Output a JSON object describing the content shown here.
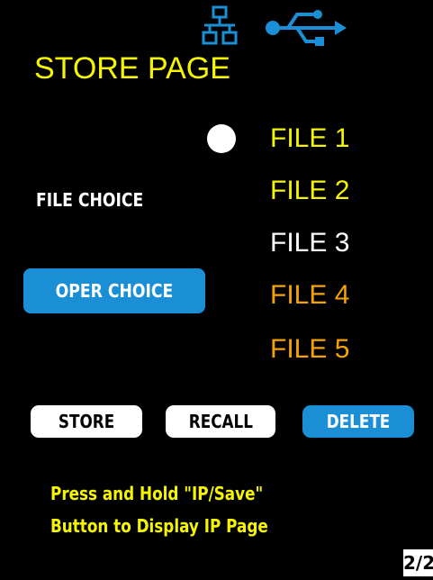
{
  "status_icons": {
    "network": "network-icon",
    "usb": "usb-icon",
    "icon_color": "#1a8fd6"
  },
  "page_title": "STORE PAGE",
  "selected_file_index": 0,
  "files": [
    {
      "label": "FILE 1",
      "color": "#f5f500"
    },
    {
      "label": "FILE 2",
      "color": "#f5f500"
    },
    {
      "label": "FILE 3",
      "color": "#ffffff"
    },
    {
      "label": "FILE 4",
      "color": "#f5a300"
    },
    {
      "label": "FILE 5",
      "color": "#f5a300"
    }
  ],
  "labels": {
    "file_choice": "FILE CHOICE",
    "oper_choice": "OPER CHOICE"
  },
  "buttons": {
    "store": "STORE",
    "recall": "RECALL",
    "delete": "DELETE"
  },
  "hint": {
    "line1": "Press and Hold \"IP/Save\"",
    "line2": "Button to Display IP Page"
  },
  "page_indicator": "2/2",
  "colors": {
    "background": "#000000",
    "accent_yellow": "#f5f500",
    "accent_orange": "#f5a300",
    "accent_blue": "#1a8fd6"
  }
}
